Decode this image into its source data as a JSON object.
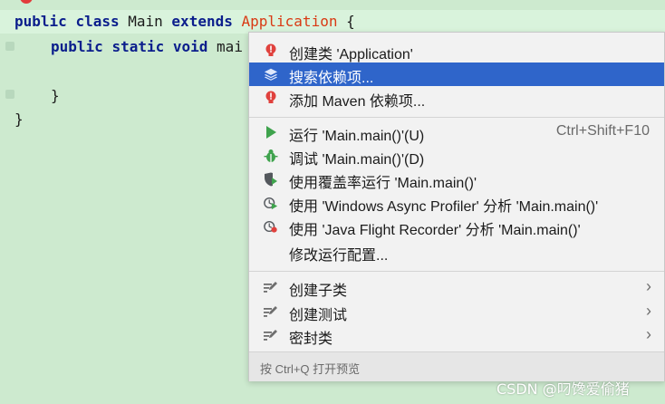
{
  "editor": {
    "line1": {
      "kw1": "public",
      "kw2": "class",
      "name": "Main",
      "kw3": "extends",
      "parent": "Application",
      "brace": "{"
    },
    "line2": {
      "kw1": "public",
      "kw2": "static",
      "kw3": "void",
      "rest": "mai"
    },
    "line4": "}",
    "line5": "}"
  },
  "menu": {
    "items": [
      {
        "label": "创建类 'Application'",
        "icon": "error-bulb-icon"
      },
      {
        "label": "搜索依赖项...",
        "icon": "layers-icon",
        "selected": true
      },
      {
        "label": "添加 Maven 依赖项...",
        "icon": "error-bulb-icon"
      },
      {
        "label": "运行 'Main.main()'(U)",
        "shortcut": "Ctrl+Shift+F10",
        "icon": "run-icon"
      },
      {
        "label": "调试 'Main.main()'(D)",
        "icon": "debug-icon"
      },
      {
        "label": "使用覆盖率运行  'Main.main()'",
        "icon": "coverage-icon"
      },
      {
        "label": "使用 'Windows Async Profiler' 分析  'Main.main()'",
        "icon": "profiler-icon"
      },
      {
        "label": "使用 'Java Flight Recorder' 分析  'Main.main()'",
        "icon": "flight-recorder-icon"
      },
      {
        "label": "修改运行配置...",
        "icon": ""
      },
      {
        "label": "创建子类",
        "icon": "intention-icon"
      },
      {
        "label": "创建测试",
        "icon": "intention-icon"
      },
      {
        "label": "密封类",
        "icon": "intention-icon"
      }
    ],
    "footer": "按 Ctrl+Q 打开预览"
  },
  "colors": {
    "editor_bg": "#cdeacf",
    "selection": "#2f65ca",
    "keyword": "#0b1e8c",
    "error_class": "#d93a14"
  },
  "watermark": "CSDN @叼馋爱偷猪"
}
